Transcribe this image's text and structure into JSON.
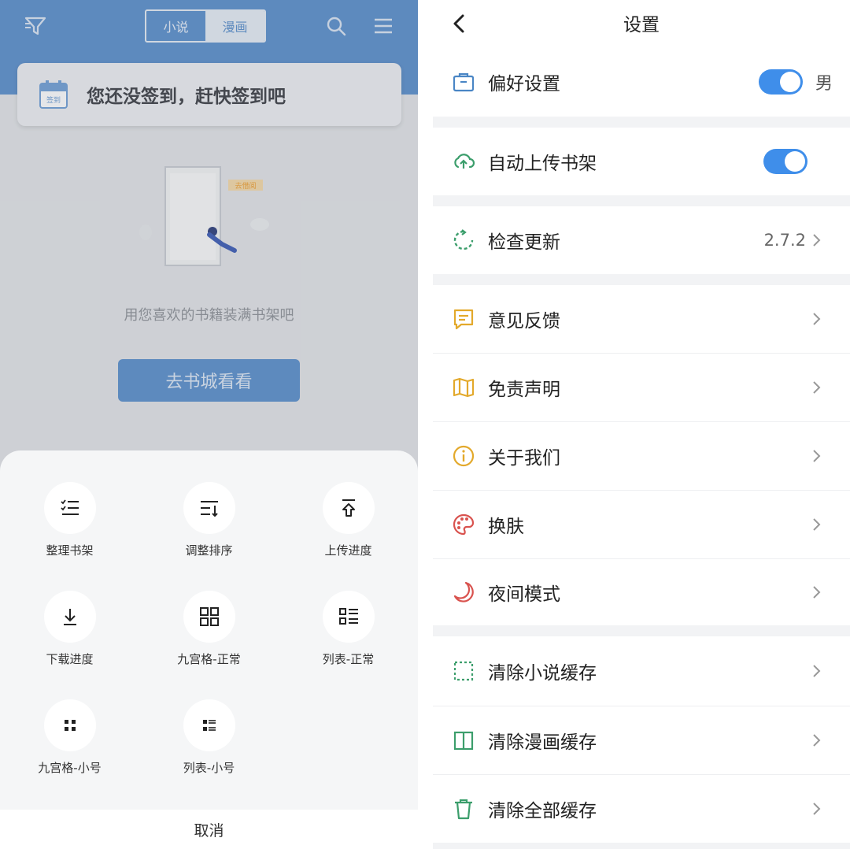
{
  "left": {
    "tabs": [
      "小说",
      "漫画"
    ],
    "active_tab": "漫画",
    "signin_text": "您还没签到，赶快签到吧",
    "calendar_badge": "签到",
    "illustration_sign": "去借阅",
    "empty_text": "用您喜欢的书籍装满书架吧",
    "goto_button": "去书城看看",
    "sheet_items": [
      {
        "label": "整理书架",
        "icon": "checklist-icon"
      },
      {
        "label": "调整排序",
        "icon": "sort-icon"
      },
      {
        "label": "上传进度",
        "icon": "upload-icon"
      },
      {
        "label": "下载进度",
        "icon": "download-icon"
      },
      {
        "label": "九宫格-正常",
        "icon": "grid-icon"
      },
      {
        "label": "列表-正常",
        "icon": "list-icon"
      },
      {
        "label": "九宫格-小号",
        "icon": "grid-small-icon"
      },
      {
        "label": "列表-小号",
        "icon": "list-small-icon"
      }
    ],
    "cancel_label": "取消"
  },
  "settings": {
    "title": "设置",
    "preference": {
      "label": "偏好设置",
      "value": "男",
      "on": true
    },
    "auto_upload": {
      "label": "自动上传书架",
      "on": true
    },
    "check_update": {
      "label": "检查更新",
      "version": "2.7.2"
    },
    "feedback": {
      "label": "意见反馈"
    },
    "disclaimer": {
      "label": "免责声明"
    },
    "about": {
      "label": "关于我们"
    },
    "skin": {
      "label": "换肤"
    },
    "night_mode": {
      "label": "夜间模式"
    },
    "clear_novel": {
      "label": "清除小说缓存"
    },
    "clear_comic": {
      "label": "清除漫画缓存"
    },
    "clear_all": {
      "label": "清除全部缓存"
    }
  },
  "colors": {
    "primary": "#5a8fcc",
    "toggle": "#3f8eea"
  }
}
